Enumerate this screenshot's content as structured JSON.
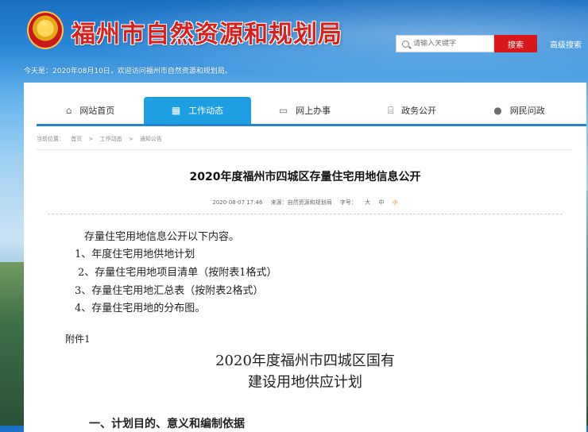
{
  "header": {
    "site_title": "福州市自然资源和规划局",
    "emblem_icon": "national-emblem-icon",
    "search": {
      "placeholder": "请输入关键字",
      "button_label": "搜索",
      "advanced_label": "高级搜索"
    },
    "welcome_text": "今天是：2020年08月10日，欢迎访问福州市自然资源和规划局。"
  },
  "nav": {
    "items": [
      {
        "label": "网站首页",
        "icon": "home-icon"
      },
      {
        "label": "工作动态",
        "icon": "grid-icon",
        "active": true
      },
      {
        "label": "网上办事",
        "icon": "monitor-icon"
      },
      {
        "label": "政务公开",
        "icon": "building-icon"
      },
      {
        "label": "网民问政",
        "icon": "person-icon"
      }
    ]
  },
  "breadcrumb": {
    "prefix": "当前位置：",
    "items": [
      "首页",
      "工作动态",
      "通知公告"
    ],
    "separator": ">"
  },
  "article": {
    "title": "2020年度福州市四城区存量住宅用地信息公开",
    "date": "2020-08-07 17:46",
    "source": "来源：自然资源和规划局",
    "font_size_label": "字号：",
    "font_sizes": [
      "大",
      "中",
      "小"
    ],
    "paragraphs": [
      "存量住宅用地信息公开以下内容。",
      "1、年度住宅用地供地计划",
      "2、存量住宅用地项目清单（按附表1格式）",
      "3、存量住宅用地汇总表（按附表2格式）",
      "4、存量住宅用地的分布图。"
    ],
    "attachment_label": "附件1",
    "plan_title_line1": "2020年度福州市四城区国有",
    "plan_title_line2": "建设用地供应计划",
    "section_heading": "一、计划目的、意义和编制依据"
  },
  "colors": {
    "brand_red": "#d9161b",
    "nav_active": "#1e9fe2",
    "title_red": "#d8211d"
  }
}
